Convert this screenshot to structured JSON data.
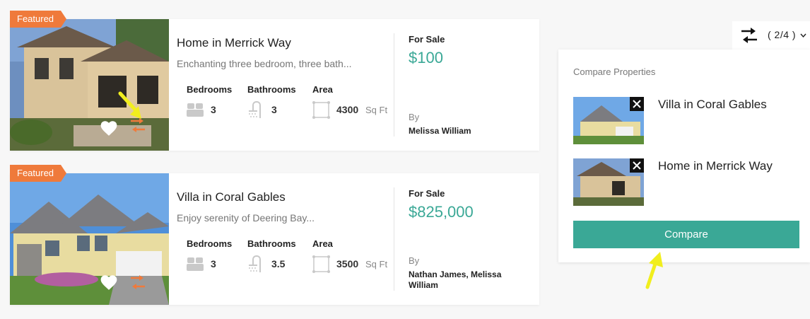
{
  "listings": [
    {
      "badge": "Featured",
      "title": "Home in Merrick Way",
      "description": "Enchanting three bedroom, three bath...",
      "features": [
        {
          "label": "Bedrooms",
          "value": "3",
          "icon": "bed-icon"
        },
        {
          "label": "Bathrooms",
          "value": "3",
          "icon": "shower-icon"
        },
        {
          "label": "Area",
          "value": "4300",
          "unit": "Sq Ft",
          "icon": "area-icon"
        }
      ],
      "status": "For Sale",
      "price": "$100",
      "by_label": "By",
      "agent": "Melissa William"
    },
    {
      "badge": "Featured",
      "title": "Villa in Coral Gables",
      "description": "Enjoy serenity of Deering Bay...",
      "features": [
        {
          "label": "Bedrooms",
          "value": "3",
          "icon": "bed-icon"
        },
        {
          "label": "Bathrooms",
          "value": "3.5",
          "icon": "shower-icon"
        },
        {
          "label": "Area",
          "value": "3500",
          "unit": "Sq Ft",
          "icon": "area-icon"
        }
      ],
      "status": "For Sale",
      "price": "$825,000",
      "by_label": "By",
      "agent": "Nathan James, Melissa William"
    }
  ],
  "compare": {
    "count": "( 2/4 )",
    "heading": "Compare Properties",
    "items": [
      {
        "name": "Villa in Coral Gables"
      },
      {
        "name": "Home in Merrick Way"
      }
    ],
    "button": "Compare"
  },
  "colors": {
    "accent": "#3aa896",
    "badge": "#ef7a3b",
    "pointer": "#f1ee1e"
  }
}
